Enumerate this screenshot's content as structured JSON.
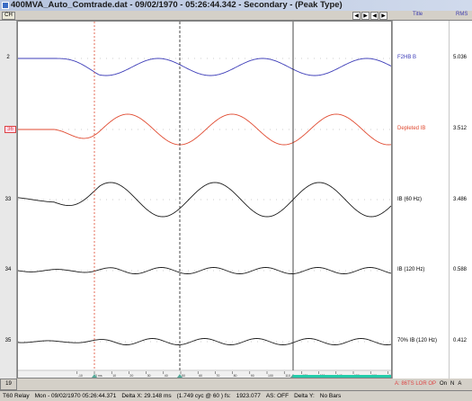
{
  "window": {
    "title": "400MVA_Auto_Comtrade.dat - 09/02/1970 - 05:26:44.342 - Secondary - (Peak Type)"
  },
  "toolbar": {
    "ch_label": "CH",
    "nav": [
      "◀",
      "▶",
      "◀",
      "▶"
    ],
    "col_title": "Title",
    "col_rms": "RMS"
  },
  "channels": [
    {
      "num": "2",
      "name": "F2HB B",
      "rms": "5.036",
      "color": "#3c3cb8"
    },
    {
      "num": "36",
      "name": "Depleted IB",
      "rms": "3.512",
      "color": "#e04a30",
      "selected": true
    },
    {
      "num": "33",
      "name": "IB (60 Hz)",
      "rms": "3.486",
      "color": "#1a1a1a"
    },
    {
      "num": "34",
      "name": "IB (120 Hz)",
      "rms": "0.588",
      "color": "#1a1a1a"
    },
    {
      "num": "35",
      "name": "70% IB (120 Hz)",
      "rms": "0.412",
      "color": "#1a1a1a"
    }
  ],
  "time_axis": {
    "ticks": [
      "-10",
      "0 ms",
      "10",
      "20",
      "30",
      "40",
      "50",
      "60",
      "70",
      "80",
      "90",
      "100",
      "110",
      "120",
      "130",
      "140",
      "150",
      "160",
      "170",
      "180",
      "190",
      "200"
    ]
  },
  "bottom": {
    "channel_count": "19",
    "relay_tag": "A: 86TS LOR OP",
    "relay_state": "On",
    "relay_flag_1": "N",
    "relay_flag_2": "A"
  },
  "status": {
    "device": "T60 Relay",
    "cursor": "Mon - 09/02/1970 05:26:44.371",
    "delta_x": "Delta X: 29.148 ms",
    "cycles": "(1.749 cyc @ 60 ) fs:",
    "fs": "1923.077",
    "as": "AS: OFF",
    "delta_y": "Delta Y:",
    "bars": "No Bars"
  }
}
